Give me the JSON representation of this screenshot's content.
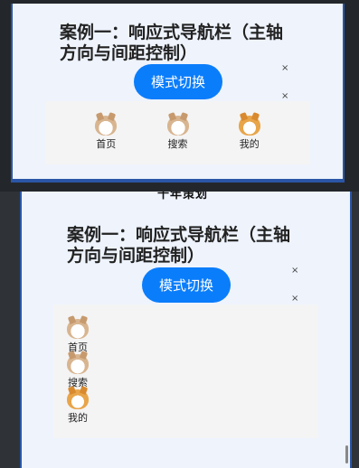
{
  "top": {
    "title": "案例一：响应式导航栏（主轴方向与间距控制）",
    "mode_button": "模式切换",
    "close_glyph": "×",
    "nav_items": [
      {
        "label": "首页",
        "icon": "dog-icon"
      },
      {
        "label": "搜索",
        "icon": "dog-icon"
      },
      {
        "label": "我的",
        "icon": "dog-orange-icon"
      }
    ]
  },
  "bottom": {
    "overlap_text": "十年策划",
    "title": "案例一：响应式导航栏（主轴方向与间距控制）",
    "mode_button": "模式切换",
    "close_glyph": "×",
    "nav_items": [
      {
        "label": "首页",
        "icon": "dog-icon"
      },
      {
        "label": "搜索",
        "icon": "dog-icon"
      },
      {
        "label": "我的",
        "icon": "dog-orange-icon"
      }
    ]
  },
  "colors": {
    "accent": "#0a7dfb",
    "frame_border": "#2b56a8",
    "screen_bg": "#eef3fc"
  }
}
